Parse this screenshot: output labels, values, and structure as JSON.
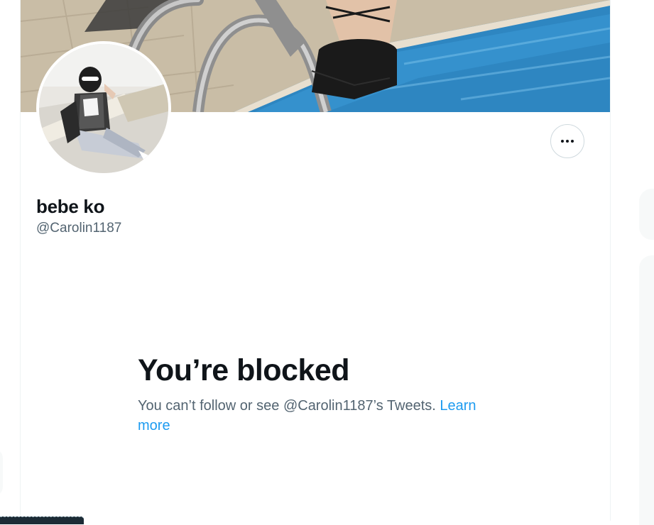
{
  "profile": {
    "display_name": "bebe ko",
    "handle": "@Carolin1187",
    "more_button_label": "More"
  },
  "blocked": {
    "title": "You’re blocked",
    "message": "You can’t follow or see @Carolin1187’s Tweets. ",
    "learn_more": "Learn more"
  },
  "colors": {
    "text_primary": "#0f1419",
    "text_secondary": "#536471",
    "link": "#1d9bf0",
    "border": "#cfd9de",
    "pool_water": "#2e86c1"
  },
  "icons": {
    "more": "more-horizontal-icon"
  }
}
